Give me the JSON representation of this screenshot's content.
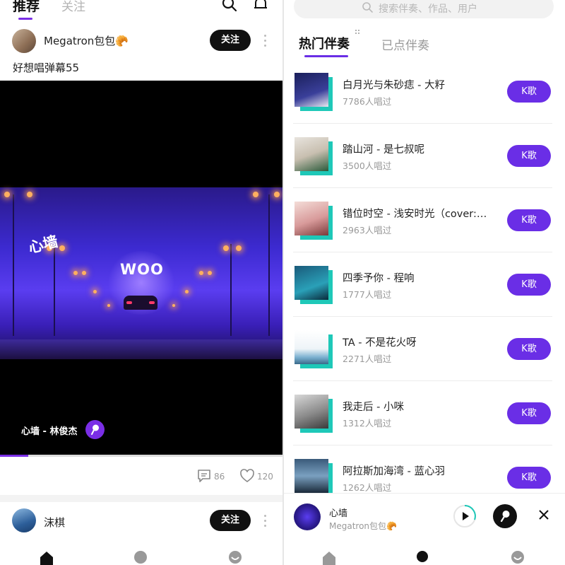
{
  "left": {
    "tabs": [
      {
        "label": "推荐",
        "active": true
      },
      {
        "label": "关注",
        "active": false
      }
    ],
    "post": {
      "username": "Megatron包包🥐",
      "follow_label": "关注",
      "text": "好想唱弹幕55",
      "video_overlay_texts": [
        "心墙",
        "WOO"
      ],
      "song_tag": "心墙 - 林俊杰",
      "progress": 0.1,
      "comment_count": "86",
      "like_count": "120"
    },
    "post2": {
      "username": "沫棋",
      "follow_label": "关注"
    }
  },
  "right": {
    "search_placeholder": "搜索伴奏、作品、用户",
    "tabs": [
      {
        "label": "热门伴奏",
        "active": true
      },
      {
        "label": "已点伴奏",
        "active": false
      }
    ],
    "k_label": "K歌",
    "songs": [
      {
        "title": "白月光与朱砂痣 - 大籽",
        "count": "7786人唱过"
      },
      {
        "title": "踏山河 - 是七叔呢",
        "count": "3500人唱过"
      },
      {
        "title": "错位时空 - 浅安时光（cover:…",
        "count": "2963人唱过"
      },
      {
        "title": "四季予你 - 程响",
        "count": "1777人唱过"
      },
      {
        "title": "TA - 不是花火呀",
        "count": "2271人唱过"
      },
      {
        "title": "我走后 - 小咪",
        "count": "1312人唱过"
      },
      {
        "title": "阿拉斯加海湾 - 蓝心羽",
        "count": "1262人唱过"
      }
    ],
    "player": {
      "title": "心墙",
      "user": "Megatron包包🥐"
    }
  },
  "colors": {
    "accent": "#6a2ee6",
    "cover_shadow": "#1ec8b8",
    "follow_bg": "#111111"
  }
}
